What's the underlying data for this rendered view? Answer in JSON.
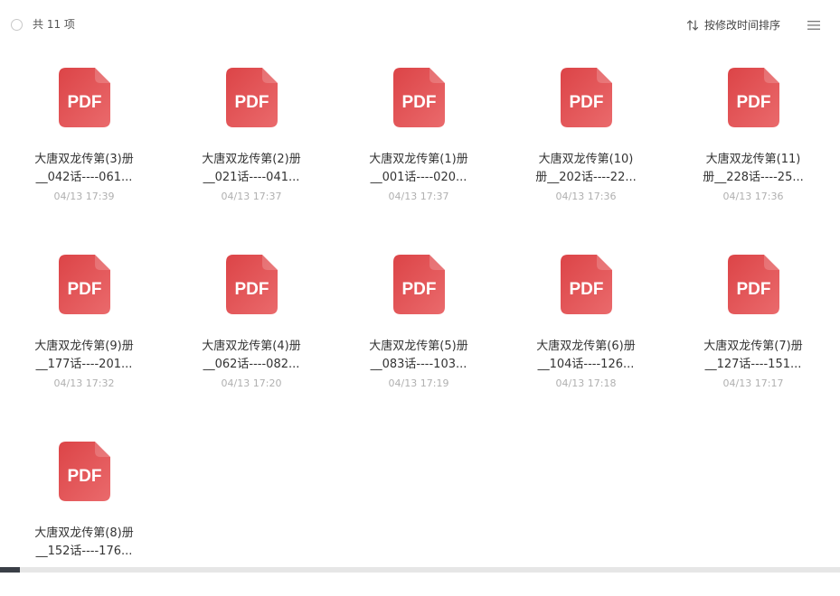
{
  "toolbar": {
    "count_label": "共 11 项",
    "sort_label": "按修改时间排序",
    "sort_icon": "sort-arrows-icon",
    "menu_icon": "list-view-icon"
  },
  "icon_label": "PDF",
  "colors": {
    "pdf_red_light": "#ea6a6c",
    "pdf_red_dark": "#dc4447",
    "date_gray": "#b0b0b0"
  },
  "files": [
    {
      "line1": "大唐双龙传第(3)册",
      "line2": "__042话----061...",
      "date": "04/13 17:39"
    },
    {
      "line1": "大唐双龙传第(2)册",
      "line2": "__021话----041...",
      "date": "04/13 17:37"
    },
    {
      "line1": "大唐双龙传第(1)册",
      "line2": "__001话----020...",
      "date": "04/13 17:37"
    },
    {
      "line1": "大唐双龙传第(10)",
      "line2": "册__202话----22...",
      "date": "04/13 17:36"
    },
    {
      "line1": "大唐双龙传第(11)",
      "line2": "册__228话----25...",
      "date": "04/13 17:36"
    },
    {
      "line1": "大唐双龙传第(9)册",
      "line2": "__177话----201...",
      "date": "04/13 17:32"
    },
    {
      "line1": "大唐双龙传第(4)册",
      "line2": "__062话----082...",
      "date": "04/13 17:20"
    },
    {
      "line1": "大唐双龙传第(5)册",
      "line2": "__083话----103...",
      "date": "04/13 17:19"
    },
    {
      "line1": "大唐双龙传第(6)册",
      "line2": "__104话----126...",
      "date": "04/13 17:18"
    },
    {
      "line1": "大唐双龙传第(7)册",
      "line2": "__127话----151...",
      "date": "04/13 17:17"
    },
    {
      "line1": "大唐双龙传第(8)册",
      "line2": "__152话----176...",
      "date": ""
    }
  ]
}
